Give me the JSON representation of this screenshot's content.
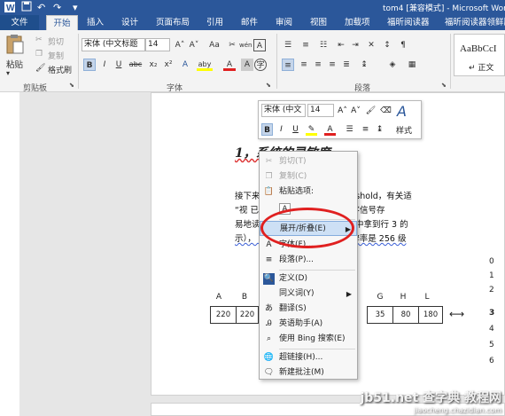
{
  "title_bar": {
    "doc_title": "tom4 [兼容模式] - Microsoft Wor",
    "qa_icons": [
      "word-icon",
      "save-icon",
      "undo-icon",
      "redo-icon",
      "customize-icon"
    ]
  },
  "tabs": [
    "文件",
    "开始",
    "插入",
    "设计",
    "页面布局",
    "引用",
    "邮件",
    "审阅",
    "视图",
    "加载项",
    "福昕阅读器",
    "福昕阅读器领鲜版"
  ],
  "ribbon": {
    "clipboard": {
      "paste": "粘贴",
      "cut": "剪切",
      "copy": "复制",
      "format_painter": "格式刷",
      "group_label": "剪贴板"
    },
    "font": {
      "font_name": "宋体 (中文标题",
      "font_size": "14",
      "grow": "A˄",
      "shrink": "A˅",
      "case": "Aa",
      "clear": "✂",
      "wen": "wén",
      "border_a": "A",
      "bold": "B",
      "italic": "I",
      "underline": "U",
      "strike": "abc",
      "sub": "x₂",
      "sup": "x²",
      "effects": "A",
      "highlight": "aby",
      "color": "A",
      "shade": "A",
      "circle": "字",
      "group_label": "字体"
    },
    "paragraph": {
      "group_label": "段落"
    },
    "styles": {
      "sample": "AaBbCcI",
      "name": "↵ 正文"
    }
  },
  "mini_toolbar": {
    "font_name": "宋体 (中文",
    "font_size": "14",
    "grow": "A˄",
    "shrink": "A˅",
    "bold": "B",
    "italic": "I",
    "styles": "样式"
  },
  "document": {
    "heading": "1，系统的灵敏度",
    "line1": "接下来                     是一个临界灰度值（threshold，有关适",
    "line2": "“视                     已经知道，当图象转换成数字信号存",
    "line3": "易地读                     。比如，我们现在从图象中拿到行 3 的",
    "line4": "示），                    确定此系统的灰度值的分辨率是 256 级",
    "col_labels": [
      "A",
      "B",
      "G",
      "H",
      "L"
    ],
    "cells": [
      "220",
      "220",
      "35",
      "80",
      "180"
    ],
    "row_numbers": [
      "0",
      "1",
      "2",
      "3",
      "4",
      "5",
      "6"
    ]
  },
  "context_menu": {
    "items": [
      {
        "label": "剪切(T)",
        "icon": "cut-icon",
        "disabled": true
      },
      {
        "label": "复制(C)",
        "icon": "copy-icon",
        "disabled": true
      },
      {
        "label": "粘贴选项:",
        "icon": "paste-icon",
        "disabled": false
      },
      {
        "label": "",
        "icon": "paste-keep-text-icon",
        "disabled": false
      },
      {
        "label": "展开/折叠(E)",
        "icon": "",
        "disabled": false,
        "submenu": true,
        "highlight": true
      },
      {
        "label": "字体(F)...",
        "icon": "font-icon",
        "disabled": false
      },
      {
        "label": "段落(P)...",
        "icon": "paragraph-icon",
        "disabled": false
      },
      {
        "label": "定义(D)",
        "icon": "define-icon",
        "disabled": false
      },
      {
        "label": "同义词(Y)",
        "icon": "",
        "disabled": false,
        "submenu": true
      },
      {
        "label": "翻译(S)",
        "icon": "translate-icon",
        "disabled": false
      },
      {
        "label": "英语助手(A)",
        "icon": "english-assistant-icon",
        "disabled": false
      },
      {
        "label": "使用 Bing 搜索(E)",
        "icon": "bing-search-icon",
        "disabled": false
      },
      {
        "label": "超链接(H)...",
        "icon": "hyperlink-icon",
        "disabled": false
      },
      {
        "label": "新建批注(M)",
        "icon": "new-comment-icon",
        "disabled": false
      }
    ]
  },
  "watermark": {
    "main": "jb51.net 查字典 教程网",
    "sub": "jiaocheng.chazidian.com"
  },
  "colors": {
    "brand": "#2b579a",
    "highlight": "#cde0f5",
    "annotation": "#e02020"
  }
}
